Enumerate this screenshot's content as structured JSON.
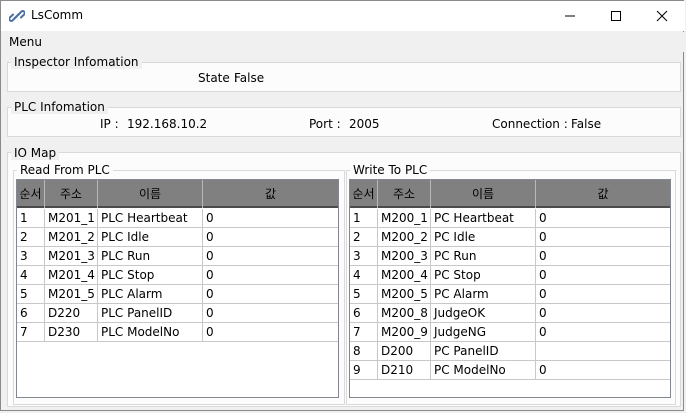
{
  "window": {
    "title": "LsComm"
  },
  "menu": {
    "label": "Menu"
  },
  "inspector": {
    "group_label": "Inspector Infomation",
    "state_label": "State :",
    "state_value": "False"
  },
  "plc": {
    "group_label": "PLC Infomation",
    "ip_label": "IP :",
    "ip_value": "192.168.10.2",
    "port_label": "Port :",
    "port_value": "2005",
    "connection_label": "Connection :",
    "connection_value": "False"
  },
  "io_map": {
    "group_label": "IO Map",
    "read": {
      "group_label": "Read From PLC",
      "columns": [
        "순서",
        "주소",
        "이름",
        "값"
      ],
      "rows": [
        [
          "1",
          "M201_1",
          "PLC Heartbeat",
          "0"
        ],
        [
          "2",
          "M201_2",
          "PLC Idle",
          "0"
        ],
        [
          "3",
          "M201_3",
          "PLC Run",
          "0"
        ],
        [
          "4",
          "M201_4",
          "PLC Stop",
          "0"
        ],
        [
          "5",
          "M201_5",
          "PLC Alarm",
          "0"
        ],
        [
          "6",
          "D220",
          "PLC PanelID",
          "0"
        ],
        [
          "7",
          "D230",
          "PLC ModelNo",
          "0"
        ]
      ]
    },
    "write": {
      "group_label": "Write To PLC",
      "columns": [
        "순서",
        "주소",
        "이름",
        "값"
      ],
      "rows": [
        [
          "1",
          "M200_1",
          "PC Heartbeat",
          "0"
        ],
        [
          "2",
          "M200_2",
          "PC Idle",
          "0"
        ],
        [
          "3",
          "M200_3",
          "PC Run",
          "0"
        ],
        [
          "4",
          "M200_4",
          "PC Stop",
          "0"
        ],
        [
          "5",
          "M200_5",
          "PC Alarm",
          "0"
        ],
        [
          "6",
          "M200_8",
          "JudgeOK",
          "0"
        ],
        [
          "7",
          "M200_9",
          "JudgeNG",
          "0"
        ],
        [
          "8",
          "D200",
          "PC PanelID",
          ""
        ],
        [
          "9",
          "D210",
          "PC ModelNo",
          "0"
        ]
      ]
    }
  },
  "icons": {
    "app": "link-icon",
    "minimize": "minimize-icon",
    "maximize": "maximize-icon",
    "close": "close-icon"
  }
}
